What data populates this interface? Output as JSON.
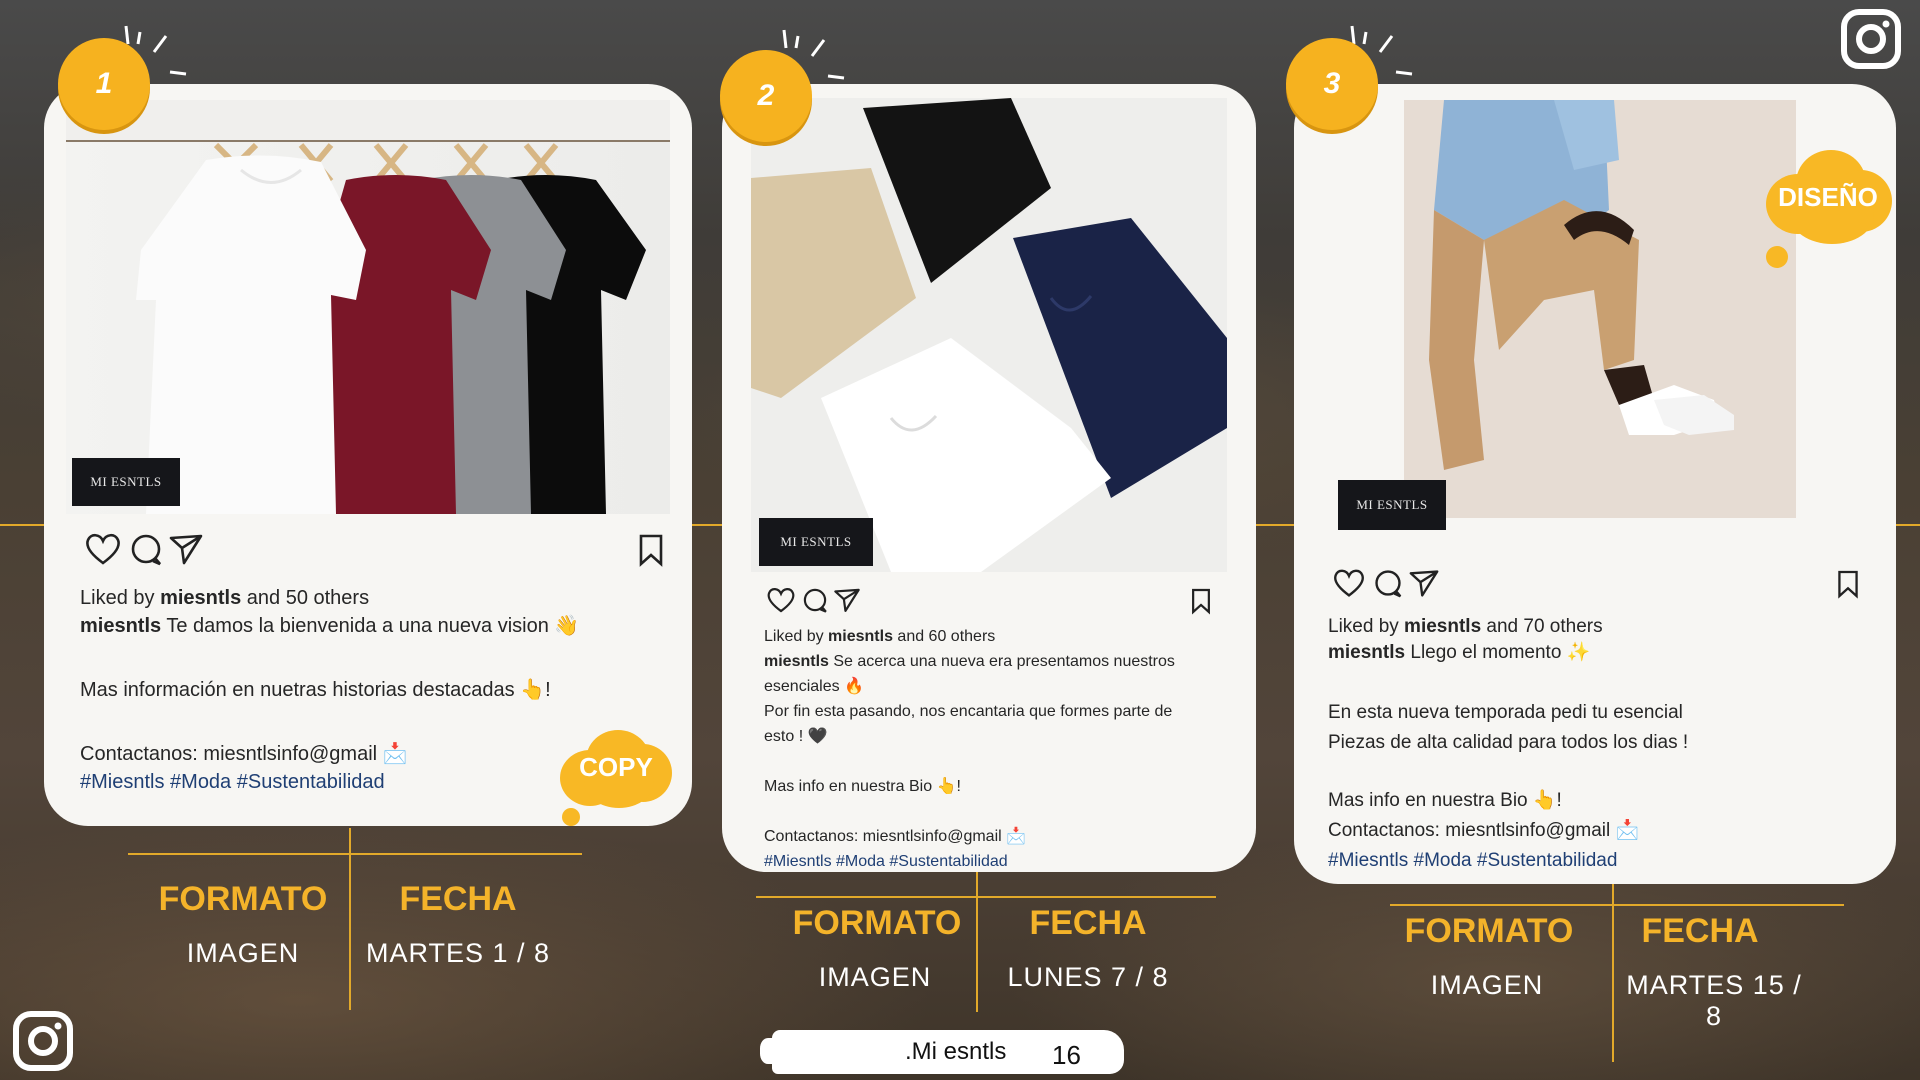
{
  "brand_tag": "MI ESNTLS",
  "posts": [
    {
      "number": "1",
      "liked_by": "Liked by ",
      "liked_user": "miesntls",
      "liked_rest": " and 50 others",
      "caption_user": "miesntls",
      "caption": " Te damos la bienvenida a una nueva vision 👋",
      "line2": "Mas información en nuetras historias destacadas 👆!",
      "contact": "Contactanos: miesntlsinfo@gmail 📩",
      "hashtags": "#Miesntls #Moda #Sustentabilidad",
      "formato_label": "FORMATO",
      "fecha_label": "FECHA",
      "formato": "IMAGEN",
      "fecha": "MARTES 1 / 8"
    },
    {
      "number": "2",
      "liked_by": "Liked by ",
      "liked_user": "miesntls",
      "liked_rest": " and 60 others",
      "caption_user": "miesntls",
      "caption": " Se acerca una nueva era presentamos nuestros",
      "caption2": "esenciales 🔥",
      "line2": "Por fin esta pasando, nos encantaria que formes parte de",
      "line2b": "esto ! 🖤",
      "line3": "Mas info en nuestra Bio 👆!",
      "contact": "Contactanos: miesntlsinfo@gmail 📩",
      "hashtags": "#Miesntls #Moda #Sustentabilidad",
      "formato_label": "FORMATO",
      "fecha_label": "FECHA",
      "formato": "IMAGEN",
      "fecha": "LUNES 7 / 8"
    },
    {
      "number": "3",
      "liked_by": "Liked by ",
      "liked_user": "miesntls",
      "liked_rest": " and 70 others",
      "caption_user": "miesntls",
      "caption": " Llego el momento ✨",
      "line2": "En esta nueva temporada pedi tu esencial",
      "line2b": "Piezas de alta calidad para todos los dias !",
      "line3": "Mas info en nuestra Bio 👆!",
      "contact": "Contactanos: miesntlsinfo@gmail 📩",
      "hashtags": "#Miesntls #Moda #Sustentabilidad",
      "formato_label": "FORMATO",
      "fecha_label": "FECHA",
      "formato": "IMAGEN",
      "fecha": "MARTES 15 / 8"
    }
  ],
  "notes": {
    "copy": "COPY",
    "diseno": "DISEÑO"
  },
  "footer": {
    "name": ".Mi esntls",
    "page": "16"
  },
  "icons": [
    "heart-icon",
    "comment-icon",
    "share-icon",
    "bookmark-icon",
    "instagram-icon"
  ],
  "colors": {
    "accent": "#f6b21f",
    "hashtag": "#1f3f74"
  }
}
